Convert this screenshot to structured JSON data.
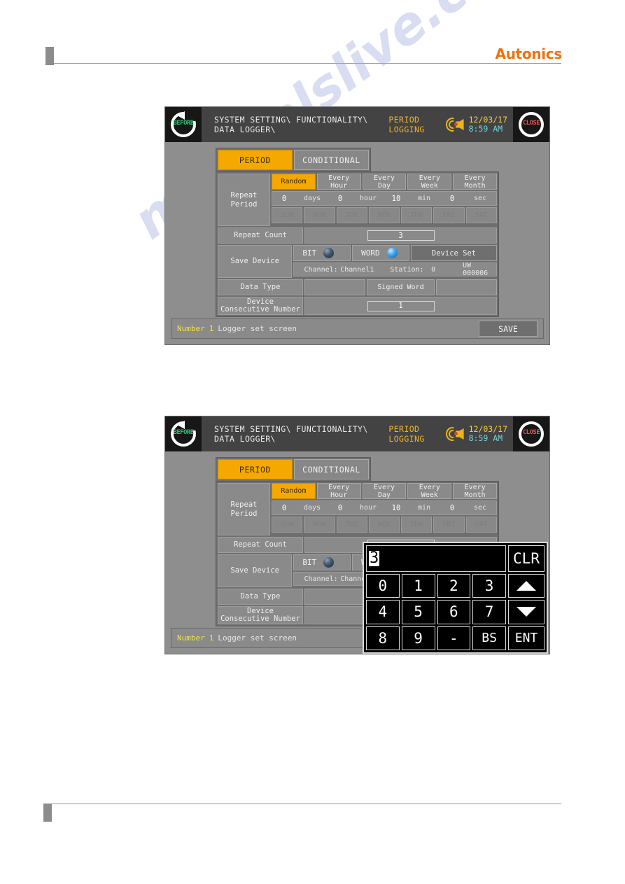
{
  "document": {
    "brand": "Autonics"
  },
  "hmi": {
    "titlebar": {
      "before_label": "BEFORE",
      "close_label": "CLOSE",
      "path_prefix": "SYSTEM SETTING\\ FUNCTIONALITY\\ DATA LOGGER\\ ",
      "path_current": "PERIOD LOGGING",
      "date": "12/03/17",
      "time": "8:59 AM",
      "buzzer_icon": "buzzer-icon"
    },
    "tabs": [
      {
        "label": "PERIOD",
        "active": true
      },
      {
        "label": "CONDITIONAL",
        "active": false
      }
    ],
    "rows": {
      "repeat_period": {
        "label": "Repeat Period",
        "modes": [
          {
            "label": "Random",
            "selected": true
          },
          {
            "label": "Every Hour",
            "selected": false
          },
          {
            "label": "Every Day",
            "selected": false
          },
          {
            "label": "Every Week",
            "selected": false
          },
          {
            "label": "Every Month",
            "selected": false
          }
        ],
        "values": [
          {
            "num": "0",
            "unit": "days"
          },
          {
            "num": "0",
            "unit": "hour"
          },
          {
            "num": "10",
            "unit": "min"
          },
          {
            "num": "0",
            "unit": "sec"
          }
        ],
        "weekdays": [
          "SUN",
          "MON",
          "TUE",
          "WED",
          "THU",
          "FRI",
          "SAT"
        ]
      },
      "repeat_count": {
        "label": "Repeat Count",
        "value": "3"
      },
      "save_device": {
        "label": "Save Device",
        "bit_label": "BIT",
        "bit_selected": false,
        "word_label": "WORD",
        "word_selected": true,
        "device_set_label": "Device Set",
        "channel_label": "Channel:",
        "channel_value": "Channel1",
        "station_label": "Station:",
        "station_value": "0",
        "address": "UW 000006"
      },
      "data_type": {
        "label": "Data Type",
        "value": "Signed Word"
      },
      "device_consecutive_number": {
        "label": "Device\nConsecutive Number",
        "value": "1"
      }
    },
    "statusbar": {
      "number_label": "Number",
      "number_value": "1",
      "text": "Logger set screen",
      "save_label": "SAVE"
    }
  },
  "keypad": {
    "display_value": "3",
    "clear_label": "CLR",
    "keys_row1": [
      "0",
      "1",
      "2",
      "3"
    ],
    "keys_row2": [
      "4",
      "5",
      "6",
      "7"
    ],
    "keys_row3": [
      "8",
      "9",
      "-",
      "BS"
    ],
    "up_label": "up-arrow-icon",
    "down_label": "down-arrow-icon",
    "enter_label": "ENT"
  },
  "colors": {
    "accent_orange": "#f5a800",
    "brand_orange": "#f2700f",
    "panel_gray": "#8e8e8e",
    "titlebar_dark": "#434343",
    "status_yellow": "#f2e23a",
    "time_cyan": "#6fd6dd"
  }
}
